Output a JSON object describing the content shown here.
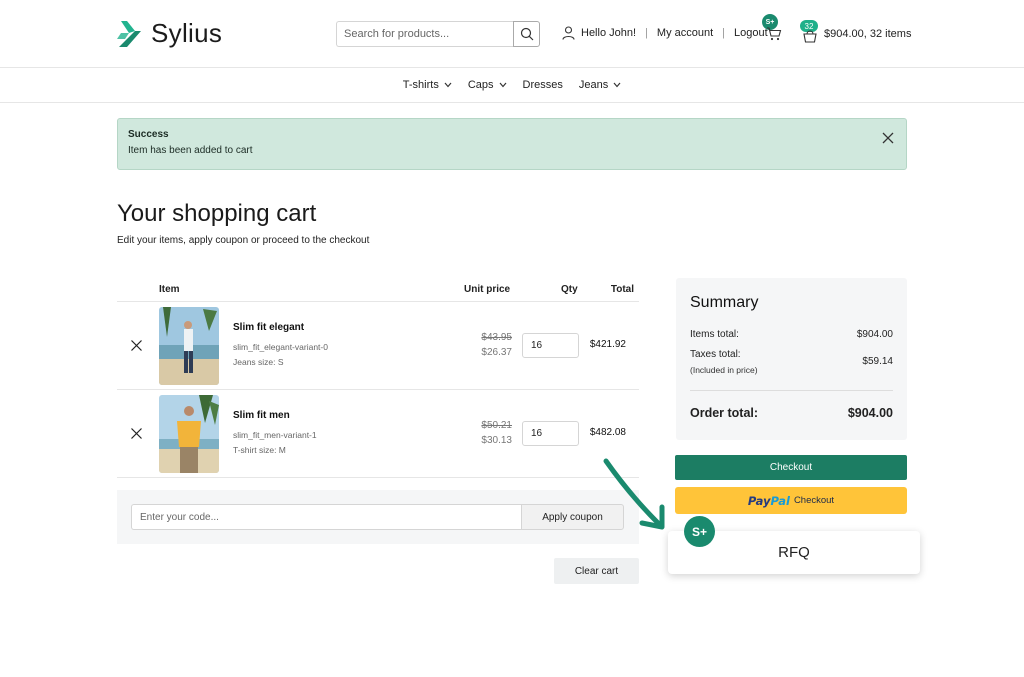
{
  "brand": {
    "name": "Sylius",
    "accent": "#1a8a6e"
  },
  "search": {
    "placeholder": "Search for products..."
  },
  "user": {
    "greeting": "Hello John!",
    "account": "My account",
    "logout": "Logout"
  },
  "rfq_badge": "S+",
  "cart": {
    "count": "32",
    "summary": "$904.00, 32 items"
  },
  "nav": [
    {
      "label": "T-shirts"
    },
    {
      "label": "Caps"
    },
    {
      "label": "Dresses"
    },
    {
      "label": "Jeans"
    }
  ],
  "alert": {
    "title": "Success",
    "message": "Item has been added to cart"
  },
  "page": {
    "title": "Your shopping cart",
    "subtitle": "Edit your items, apply coupon or proceed to the checkout"
  },
  "table": {
    "headers": {
      "item": "Item",
      "unit_price": "Unit price",
      "qty": "Qty",
      "total": "Total"
    },
    "rows": [
      {
        "name": "Slim fit elegant",
        "code": "slim_fit_elegant-variant-0",
        "variant": "Jeans size: S",
        "old_price": "$43.95",
        "price": "$26.37",
        "qty": "16",
        "total": "$421.92"
      },
      {
        "name": "Slim fit men",
        "code": "slim_fit_men-variant-1",
        "variant": "T-shirt size: M",
        "old_price": "$50.21",
        "price": "$30.13",
        "qty": "16",
        "total": "$482.08"
      }
    ]
  },
  "coupon": {
    "placeholder": "Enter your code...",
    "apply": "Apply coupon"
  },
  "clear": "Clear cart",
  "summary": {
    "title": "Summary",
    "items_label": "Items total:",
    "items_value": "$904.00",
    "taxes_label": "Taxes total:",
    "taxes_value": "$59.14",
    "taxes_note": "(Included in price)",
    "order_label": "Order total:",
    "order_value": "$904.00"
  },
  "checkout": "Checkout",
  "paypal": {
    "pay": "Pay",
    "pal": "Pal",
    "checkout": "Checkout"
  },
  "rfq": {
    "label": "RFQ",
    "badge": "S+"
  }
}
